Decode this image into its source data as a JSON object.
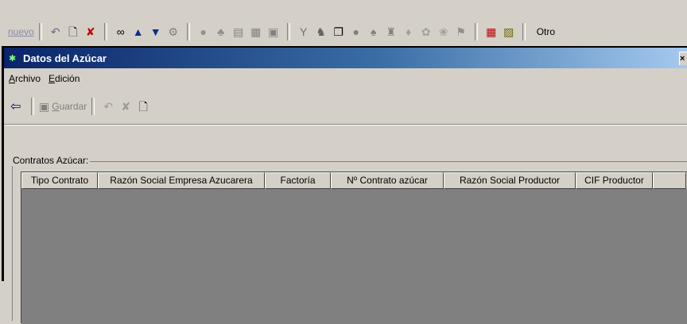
{
  "app_toolbar": {
    "nuevo_label": "nuevo",
    "otro_label": "Otro",
    "icons": [
      "undo-icon",
      "new-document-icon",
      "delete-record-icon",
      "binoculars-icon",
      "arrow-up-icon",
      "arrow-down-icon",
      "gear-icon",
      "circle-icon",
      "apple-icon",
      "form-icon",
      "form2-icon",
      "report-icon",
      "tool-icon",
      "wolf-icon",
      "window-icon",
      "fruit-icon",
      "leaf-icon",
      "bottle-icon",
      "plant-icon",
      "grapes-icon",
      "harvest-icon",
      "flag-icon",
      "grid-icon",
      "note-icon"
    ]
  },
  "window": {
    "title": "Datos del Azúcar",
    "close_glyph": "×"
  },
  "menu": {
    "archivo_u": "A",
    "archivo_rest": "rchivo",
    "edicion_u": "E",
    "edicion_rest": "dición"
  },
  "window_toolbar": {
    "guardar_u": "G",
    "guardar_rest": "uardar"
  },
  "groupbox": {
    "label": "Contratos Azúcar:"
  },
  "grid": {
    "columns": [
      "Tipo Contrato",
      "Razón Social Empresa Azucarera",
      "Factoría",
      "Nº Contrato azúcar",
      "Razón Social Productor",
      "CIF Productor",
      ""
    ]
  },
  "colors": {
    "face": "#d4d0c8",
    "titlebar_start": "#0a246a",
    "titlebar_end": "#a6caf0",
    "grid_body": "#808080"
  }
}
